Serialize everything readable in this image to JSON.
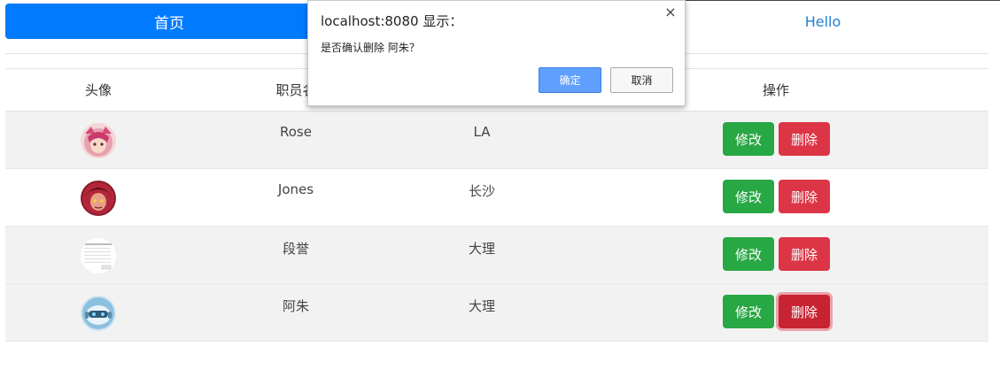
{
  "nav": {
    "home_label": "首页",
    "hello_label": "Hello"
  },
  "table": {
    "headers": {
      "avatar": "头像",
      "name": "职员名",
      "operation": "操作"
    },
    "rows": [
      {
        "name": "Rose",
        "city": "LA",
        "avatar_icon": "pink-hair-character-avatar",
        "edit": "修改",
        "delete": "删除"
      },
      {
        "name": "Jones",
        "city": "长沙",
        "avatar_icon": "red-character-avatar",
        "edit": "修改",
        "delete": "删除"
      },
      {
        "name": "段誉",
        "city": "大理",
        "avatar_icon": "document-screenshot-avatar",
        "edit": "修改",
        "delete": "删除"
      },
      {
        "name": "阿朱",
        "city": "大理",
        "avatar_icon": "robot-character-avatar",
        "edit": "修改",
        "delete": "删除"
      }
    ]
  },
  "dialog": {
    "title": "localhost:8080 显示：",
    "message": "是否确认删除 阿朱？",
    "ok_label": "确定",
    "cancel_label": "取消",
    "close_glyph": "×"
  },
  "colors": {
    "primary": "#007bff",
    "success": "#28a745",
    "danger": "#dc3545",
    "link": "#1f7fd6"
  }
}
